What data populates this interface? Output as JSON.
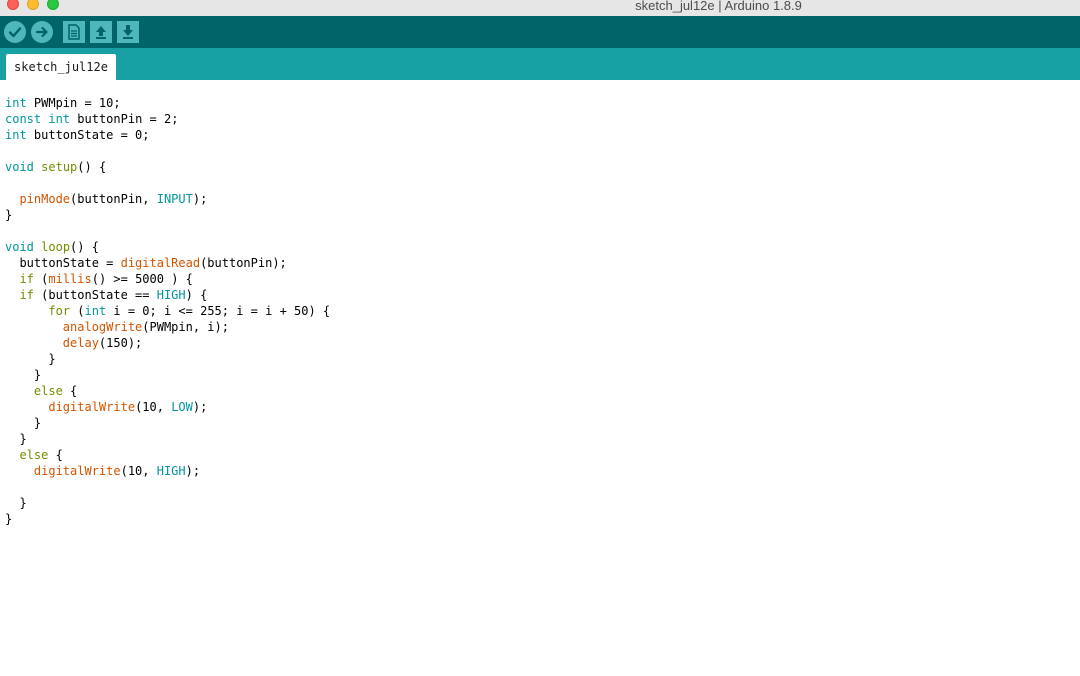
{
  "window": {
    "title": "sketch_jul12e | Arduino 1.8.9"
  },
  "toolbar": {
    "buttons": [
      {
        "icon": "check-icon",
        "action": "verify"
      },
      {
        "icon": "arrow-right-icon",
        "action": "upload"
      },
      {
        "icon": "new-file-icon",
        "action": "new"
      },
      {
        "icon": "arrow-up-icon",
        "action": "open"
      },
      {
        "icon": "arrow-down-icon",
        "action": "save"
      }
    ]
  },
  "tabs": [
    {
      "label": "sketch_jul12e",
      "active": true
    }
  ],
  "colors": {
    "toolbar_bg": "#006468",
    "tabbar_bg": "#17a1a5",
    "button_bg": "#4db7bb",
    "keyword": "#00979c",
    "function": "#d35400",
    "control": "#728e00"
  },
  "code": {
    "lines": [
      [
        {
          "t": "int",
          "c": "kw"
        },
        {
          "t": " PWMpin = 10;"
        }
      ],
      [
        {
          "t": "const",
          "c": "kw"
        },
        {
          "t": " "
        },
        {
          "t": "int",
          "c": "kw"
        },
        {
          "t": " buttonPin = 2;"
        }
      ],
      [
        {
          "t": "int",
          "c": "kw"
        },
        {
          "t": " buttonState = 0;"
        }
      ],
      [],
      [
        {
          "t": "void",
          "c": "kw"
        },
        {
          "t": " "
        },
        {
          "t": "setup",
          "c": "ctl"
        },
        {
          "t": "() {"
        }
      ],
      [],
      [
        {
          "t": "  "
        },
        {
          "t": "pinMode",
          "c": "fn"
        },
        {
          "t": "(buttonPin, "
        },
        {
          "t": "INPUT",
          "c": "cst"
        },
        {
          "t": ");"
        }
      ],
      [
        {
          "t": "}"
        }
      ],
      [],
      [
        {
          "t": "void",
          "c": "kw"
        },
        {
          "t": " "
        },
        {
          "t": "loop",
          "c": "ctl"
        },
        {
          "t": "() {"
        }
      ],
      [
        {
          "t": "  buttonState = "
        },
        {
          "t": "digitalRead",
          "c": "fn"
        },
        {
          "t": "(buttonPin);"
        }
      ],
      [
        {
          "t": "  "
        },
        {
          "t": "if",
          "c": "ctl"
        },
        {
          "t": " ("
        },
        {
          "t": "millis",
          "c": "fn"
        },
        {
          "t": "() >= 5000 ) {"
        }
      ],
      [
        {
          "t": "  "
        },
        {
          "t": "if",
          "c": "ctl"
        },
        {
          "t": " (buttonState == "
        },
        {
          "t": "HIGH",
          "c": "cst"
        },
        {
          "t": ") {"
        }
      ],
      [
        {
          "t": "      "
        },
        {
          "t": "for",
          "c": "ctl"
        },
        {
          "t": " ("
        },
        {
          "t": "int",
          "c": "kw"
        },
        {
          "t": " i = 0; i <= 255; i = i + 50) {"
        }
      ],
      [
        {
          "t": "        "
        },
        {
          "t": "analogWrite",
          "c": "fn"
        },
        {
          "t": "(PWMpin, i);"
        }
      ],
      [
        {
          "t": "        "
        },
        {
          "t": "delay",
          "c": "fn"
        },
        {
          "t": "(150);"
        }
      ],
      [
        {
          "t": "      }"
        }
      ],
      [
        {
          "t": "    }"
        }
      ],
      [
        {
          "t": "    "
        },
        {
          "t": "else",
          "c": "ctl"
        },
        {
          "t": " {"
        }
      ],
      [
        {
          "t": "      "
        },
        {
          "t": "digitalWrite",
          "c": "fn"
        },
        {
          "t": "(10, "
        },
        {
          "t": "LOW",
          "c": "cst"
        },
        {
          "t": ");"
        }
      ],
      [
        {
          "t": "    }"
        }
      ],
      [
        {
          "t": "  }"
        }
      ],
      [
        {
          "t": "  "
        },
        {
          "t": "else",
          "c": "ctl"
        },
        {
          "t": " {"
        }
      ],
      [
        {
          "t": "    "
        },
        {
          "t": "digitalWrite",
          "c": "fn"
        },
        {
          "t": "(10, "
        },
        {
          "t": "HIGH",
          "c": "cst"
        },
        {
          "t": ");"
        }
      ],
      [],
      [
        {
          "t": "  }"
        }
      ],
      [
        {
          "t": "}"
        }
      ]
    ]
  }
}
